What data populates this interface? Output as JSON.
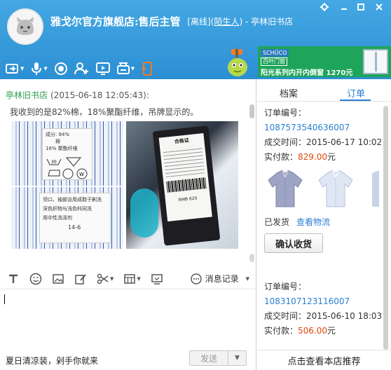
{
  "header": {
    "shop_name": "雅戈尔官方旗舰店:售后主管",
    "status_open": "[离线](",
    "stranger": "陌生人",
    "status_close": ") - 亭林旧书店",
    "window_controls": [
      "gear-icon",
      "minimize-icon",
      "maximize-icon",
      "close-icon"
    ],
    "toolbar": [
      "screen-share-icon",
      "microphone-icon",
      "camera-icon",
      "add-contact-icon",
      "remote-assist-icon",
      "transfer-file-icon",
      "mobile-icon"
    ]
  },
  "ad": {
    "brand": "SCHÜCO",
    "sub": "百叶门窗",
    "text": "阳光系列内开内倒窗 1270元"
  },
  "chat": {
    "sender": "亭林旧书店",
    "timestamp": "(2015-06-18 12:05:43):",
    "message": "我收到的是82%棉，18%聚酯纤维，吊牌显示的。",
    "image1": {
      "line1": "成分: 84%",
      "line2": "棉",
      "line3": "16% 聚酯纤维"
    },
    "image2": {
      "line1": "合格证",
      "line2": "RMB 620"
    },
    "image3": {
      "line1": "领口、袖部设用成鞋子刷洗",
      "line2": "深色织物与浅色科同洗",
      "line3": "用中性洗涤剂",
      "line4": "14-6"
    },
    "history_label": "消息记录",
    "slogan": "夏日清凉装，剁手你就来",
    "send_label": "发送"
  },
  "side": {
    "tab_profile": "档案",
    "tab_orders": "订单",
    "orders": [
      {
        "id_label": "订单编号：",
        "id": "1087573540636007",
        "time_label": "成交时间：",
        "time": "2015-06-17 10:02",
        "paid_label": "实付款：",
        "amount": "829.00",
        "currency": "元",
        "status": "已发货",
        "track_label": "查看物流",
        "confirm_label": "确认收货"
      },
      {
        "id_label": "订单编号：",
        "id": "1083107123116007",
        "time_label": "成交时间：",
        "time": "2015-06-10 18:03",
        "paid_label": "实付款：",
        "amount": "506.00",
        "currency": "元"
      }
    ],
    "footer": "点击查看本店推荐"
  },
  "colors": {
    "header_blue": "#2b8fd3",
    "order_link": "#2a7fd4",
    "price_red": "#e1460b",
    "sender_green": "#2e9b4e"
  }
}
